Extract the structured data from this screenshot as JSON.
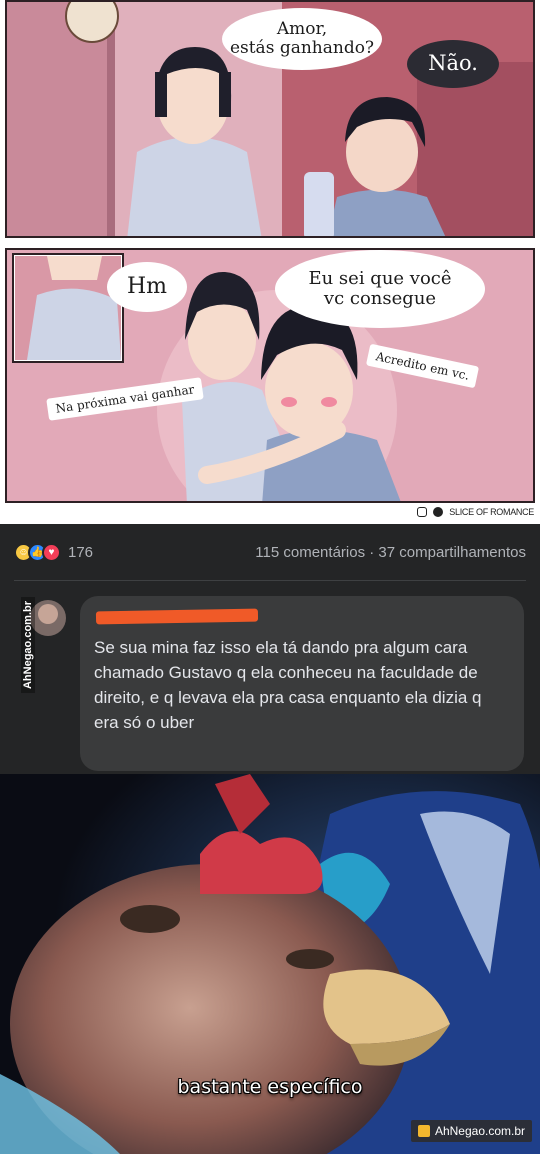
{
  "comic": {
    "panel1": {
      "speech_her": "Amor,\nestás ganhando?",
      "speech_him": "Não."
    },
    "panel2": {
      "speech_hm": "Hm",
      "speech_main": "Eu sei que você\nvc consegue",
      "caption_left": "Na próxima vai ganhar",
      "caption_right": "Acredito em vc."
    },
    "credit": "SLICE OF ROMANCE"
  },
  "facebook": {
    "reactions": [
      "haha",
      "like",
      "love"
    ],
    "reaction_count": "176",
    "comments_meta": "115 comentários · 37 compartilhamentos",
    "watermark": "AhNegao.com.br",
    "comment_text": "Se sua mina faz isso ela tá dando pra algum cara chamado Gustavo q ela conheceu na faculdade de direito, e q levava ela pra casa enquanto ela dizia q era só o uber"
  },
  "meme": {
    "caption": "bastante específico",
    "watermark": "AhNegao.com.br"
  },
  "colors": {
    "fb_background": "#242526",
    "comment_bubble": "#3a3b3c",
    "redaction": "#f05a28",
    "panel1_bg": "#c98a9a",
    "panel2_bg": "#e2a9b8"
  }
}
